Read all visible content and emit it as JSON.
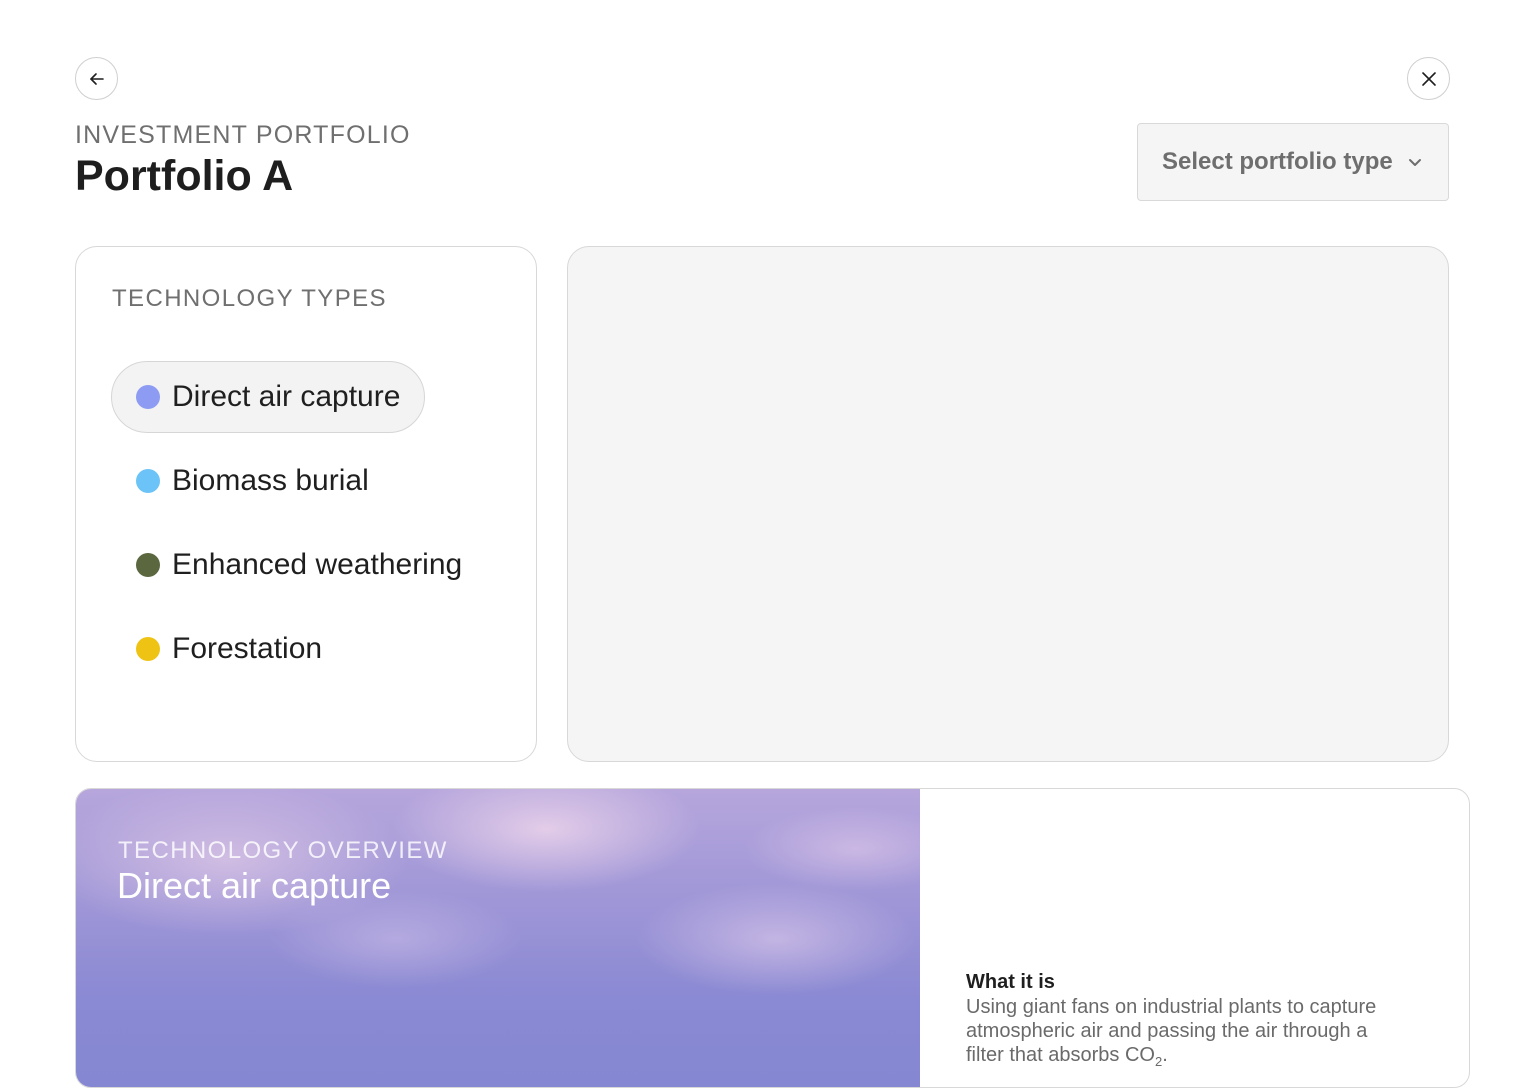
{
  "nav": {
    "back_icon": "arrow-left-icon",
    "close_icon": "close-icon"
  },
  "header": {
    "eyebrow": "INVESTMENT PORTFOLIO",
    "title": "Portfolio A"
  },
  "portfolio_select": {
    "label": "Select portfolio type",
    "icon": "chevron-down-icon"
  },
  "technology_types": {
    "heading": "TECHNOLOGY TYPES",
    "items": [
      {
        "label": "Direct air capture",
        "color": "#8d9cf2",
        "selected": true
      },
      {
        "label": "Biomass burial",
        "color": "#6cc3f7",
        "selected": false
      },
      {
        "label": "Enhanced weathering",
        "color": "#5a673f",
        "selected": false
      },
      {
        "label": "Forestation",
        "color": "#eec313",
        "selected": false
      }
    ]
  },
  "overview": {
    "eyebrow": "TECHNOLOGY OVERVIEW",
    "title": "Direct air capture",
    "what_heading": "What it is",
    "what_body": "Using giant fans on industrial plants to capture atmospheric air and passing the air through a filter that absorbs CO",
    "what_body_sub": "2",
    "what_body_end": "."
  },
  "colors": {
    "panel_background": "#f5f5f5",
    "border": "#d8d8d8",
    "sky_top": "#b6a6dc",
    "sky_bottom": "#8587d2"
  }
}
